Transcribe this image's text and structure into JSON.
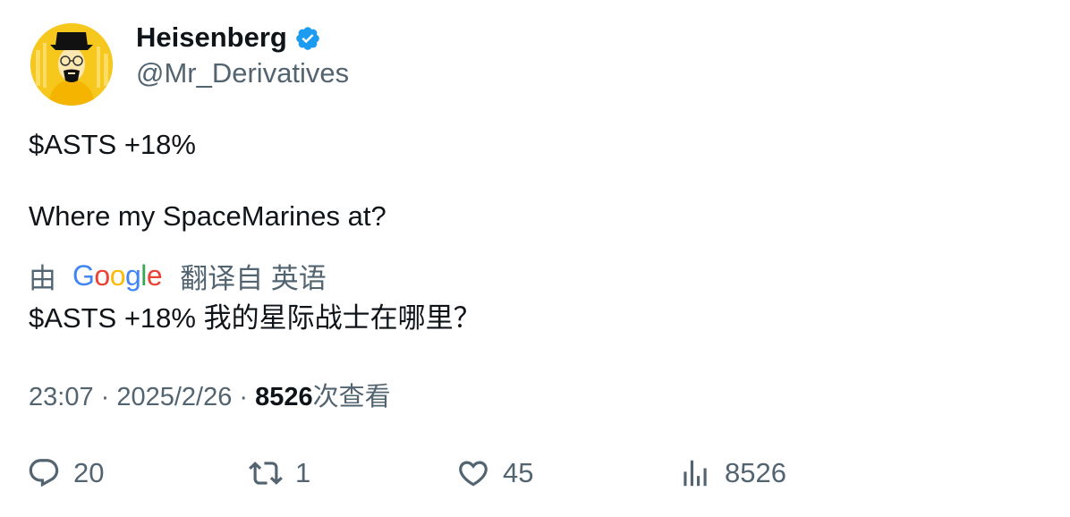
{
  "author": {
    "display_name": "Heisenberg",
    "handle": "@Mr_Derivatives"
  },
  "tweet": {
    "text": "$ASTS +18%\n\nWhere my SpaceMarines at?"
  },
  "translation": {
    "prefix": "由",
    "provider": "Google",
    "suffix": "翻译自 英语",
    "text": "$ASTS +18% 我的星际战士在哪里？"
  },
  "meta": {
    "time": "23:07",
    "sep1": " · ",
    "date": "2025/2/26",
    "sep2": " · ",
    "views": "8526",
    "views_label": "次查看"
  },
  "actions": {
    "replies": "20",
    "retweets": "1",
    "likes": "45",
    "views": "8526"
  },
  "colors": {
    "verified": "#1d9bf0",
    "secondary_text": "#536471",
    "primary_text": "#0f1419",
    "google_blue": "#4285F4",
    "google_red": "#EA4335",
    "google_yellow": "#FBBC05",
    "google_green": "#34A853"
  }
}
